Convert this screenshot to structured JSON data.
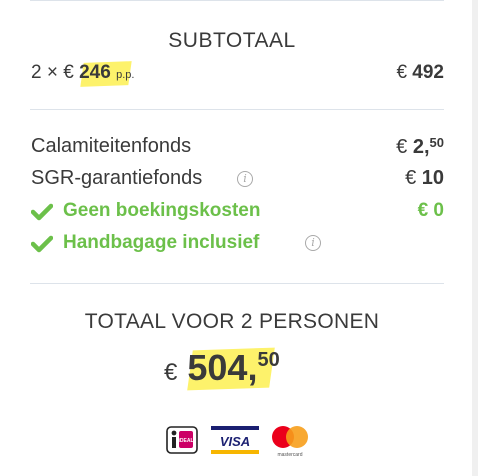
{
  "subtotal": {
    "heading": "SUBTOTAAL",
    "multiplier": "2 ×",
    "currency": "€",
    "price_per_person": "246",
    "pp": "p.p.",
    "total_currency": "€",
    "total": "492"
  },
  "fees": {
    "calamity_fund_label": "Calamiteitenfonds",
    "calamity_fund_currency": "€",
    "calamity_fund_whole": "2,",
    "calamity_fund_cents": "50",
    "sgr_label": "SGR-garantiefonds",
    "sgr_currency": "€",
    "sgr_value": "10",
    "booking_costs_label": "Geen boekingskosten",
    "booking_costs_value": "€ 0",
    "hand_luggage_label": "Handbagage inclusief"
  },
  "total": {
    "heading": "TOTAAL VOOR 2 PERSONEN",
    "currency": "€",
    "whole": "504,",
    "cents": "50"
  },
  "payment_methods": {
    "ideal": "iDEAL",
    "visa": "VISA",
    "mastercard": "mastercard"
  },
  "colors": {
    "highlight": "#fdf26b",
    "green": "#6cc04a",
    "text": "#3a3a3a",
    "divider": "#dde3ea"
  },
  "icons": [
    "check-icon",
    "info-icon",
    "ideal-logo",
    "visa-logo",
    "mastercard-logo"
  ]
}
